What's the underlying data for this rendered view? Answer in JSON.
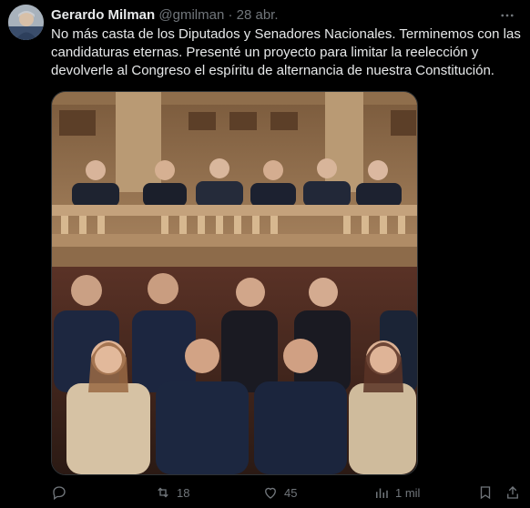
{
  "tweet": {
    "author_name": "Gerardo Milman",
    "handle": "@gmilman",
    "separator": "·",
    "date": "28 abr.",
    "text": "No más casta de los Diputados y Senadores Nacionales. Terminemos con las candidaturas eternas. Presenté un proyecto para limitar la reelección y devolverle al Congreso el espíritu de alternancia de nuestra Constitución.",
    "more_icon": "more-horizontal-icon"
  },
  "media": {
    "kind": "image",
    "description_icon": "photo"
  },
  "actions": {
    "reply_count": "",
    "retweet_count": "18",
    "like_count": "45",
    "views_count": "1 mil"
  },
  "colors": {
    "background": "#000000",
    "text": "#e7e9ea",
    "muted": "#71767b",
    "border": "#2f3336"
  }
}
